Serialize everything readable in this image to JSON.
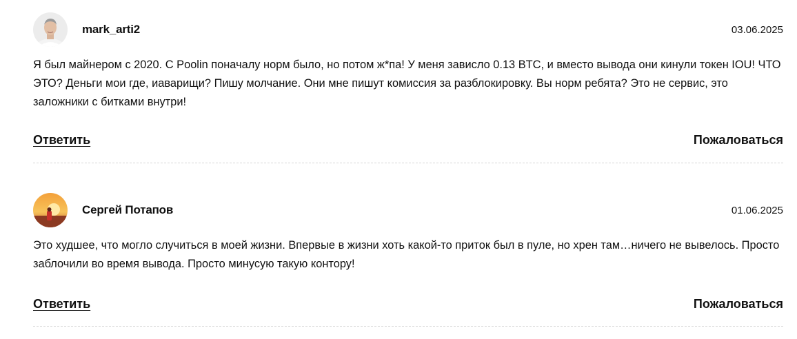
{
  "comments": [
    {
      "author": "mark_arti2",
      "date": "03.06.2025",
      "text": "Я был майнером с 2020. С Poolin поначалу норм было, но потом ж*па! У меня зависло 0.13 BTC, и вместо вывода они кинули токен IOU! ЧТО ЭТО? Деньги мои где, иаварищи? Пишу молчание. Они мне пишут комиссия за разблокировку. Вы норм ребята? Это не сервис, это заложники с битками внутри!",
      "reply_label": "Ответить",
      "report_label": "Пожаловаться",
      "avatar_icon": "user-photo-avatar"
    },
    {
      "author": "Сергей Потапов",
      "date": "01.06.2025",
      "text": "Это худшее, что могло случиться в моей жизни. Впервые в жизни хоть какой-то приток был в пуле, но хрен там…ничего не вывелось. Просто заблочили во время вывода. Просто минусую такую контору!",
      "reply_label": "Ответить",
      "report_label": "Пожаловаться",
      "avatar_icon": "sunset-photo-avatar"
    }
  ]
}
